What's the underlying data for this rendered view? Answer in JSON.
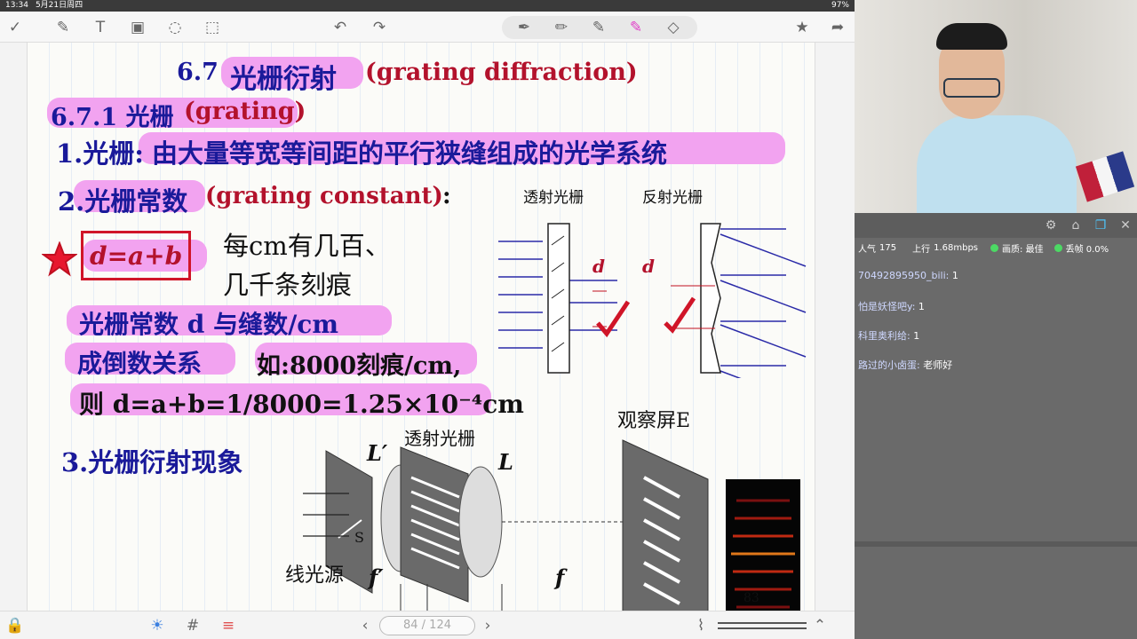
{
  "status": {
    "time": "13:34",
    "date": "5月21日周四",
    "battery": "97%"
  },
  "slide": {
    "title_num": "6.7",
    "title_zh": "光栅衍射",
    "title_en": "(grating diffraction)",
    "sub_num": "6.7.1 光栅",
    "sub_en": "(grating)",
    "item1_label": "1.光栅:",
    "item1_text": "由大量等宽等间距的平行狭缝组成的光学系统",
    "item2_label": "2.光栅常数",
    "item2_en": "(grating constant)",
    "item2_colon": ":",
    "formula": "d=a+b",
    "note1": "每cm有几百、",
    "note2": "几千条刻痕",
    "rel1": "光栅常数 d 与缝数/cm",
    "rel2": "成倒数关系",
    "rel3": "如:8000刻痕/cm,",
    "rel4": "则 d=a+b=1/8000=1.25×10⁻⁴cm",
    "item3": "3.光栅衍射现象",
    "fig_trans": "透射光栅",
    "fig_refl": "反射光栅",
    "fig_d": "d",
    "fig_screen": "观察屏E",
    "fig_grating": "透射光栅",
    "fig_Lp": "L′",
    "fig_L": "L",
    "fig_S": "S",
    "fig_source": "线光源",
    "fig_fp": "f′",
    "fig_f": "f",
    "fig_num": "83"
  },
  "pager": {
    "label": "84 / 124"
  },
  "live": {
    "popularity_label": "人气",
    "popularity": "175",
    "upload_label": "上行",
    "upload": "1.68mbps",
    "quality_label": "画质: 最佳",
    "drop_label": "丢帧 0.0%"
  },
  "chat": [
    {
      "user": "70492895950_bili:",
      "msg": "1"
    },
    {
      "user": "怕是妖怪吧y:",
      "msg": "1"
    },
    {
      "user": "科里奥利给:",
      "msg": "1"
    },
    {
      "user": "路过的小卤蛋:",
      "msg": "老师好"
    }
  ],
  "colors": {
    "highlight": "#f2a3f0",
    "blue_text": "#1a1a9a",
    "red_text": "#b3122c"
  }
}
